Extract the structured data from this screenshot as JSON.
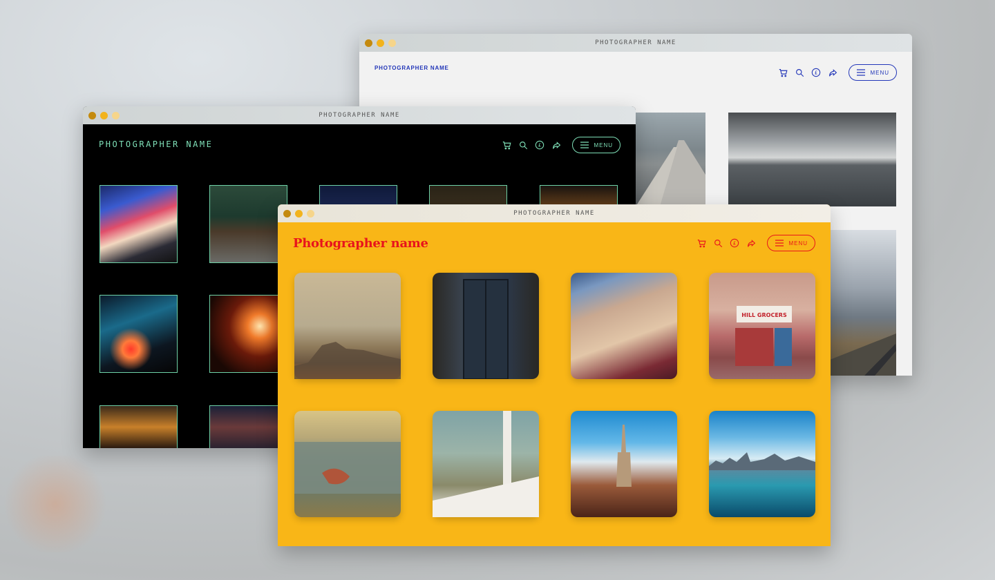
{
  "windows": [
    {
      "id": "white",
      "title": "PHOTOGRAPHER NAME",
      "brand": "PHOTOGRAPHER NAME",
      "menu_label": "MENU",
      "accent": "#2236b8",
      "icons": [
        "cart-icon",
        "search-icon",
        "currency-pound-icon",
        "share-icon",
        "hamburger-icon"
      ]
    },
    {
      "id": "black",
      "title": "PHOTOGRAPHER NAME",
      "brand": "PHOTOGRAPHER NAME",
      "menu_label": "MENU",
      "accent": "#7fe0b8",
      "icons": [
        "cart-icon",
        "search-icon",
        "currency-pound-icon",
        "share-icon",
        "hamburger-icon"
      ]
    },
    {
      "id": "yellow",
      "title": "PHOTOGRAPHER NAME",
      "brand": "Photographer name",
      "menu_label": "MENU",
      "accent": "#e8141c",
      "icons": [
        "cart-icon",
        "search-icon",
        "currency-pound-icon",
        "share-icon",
        "hamburger-icon"
      ]
    }
  ]
}
